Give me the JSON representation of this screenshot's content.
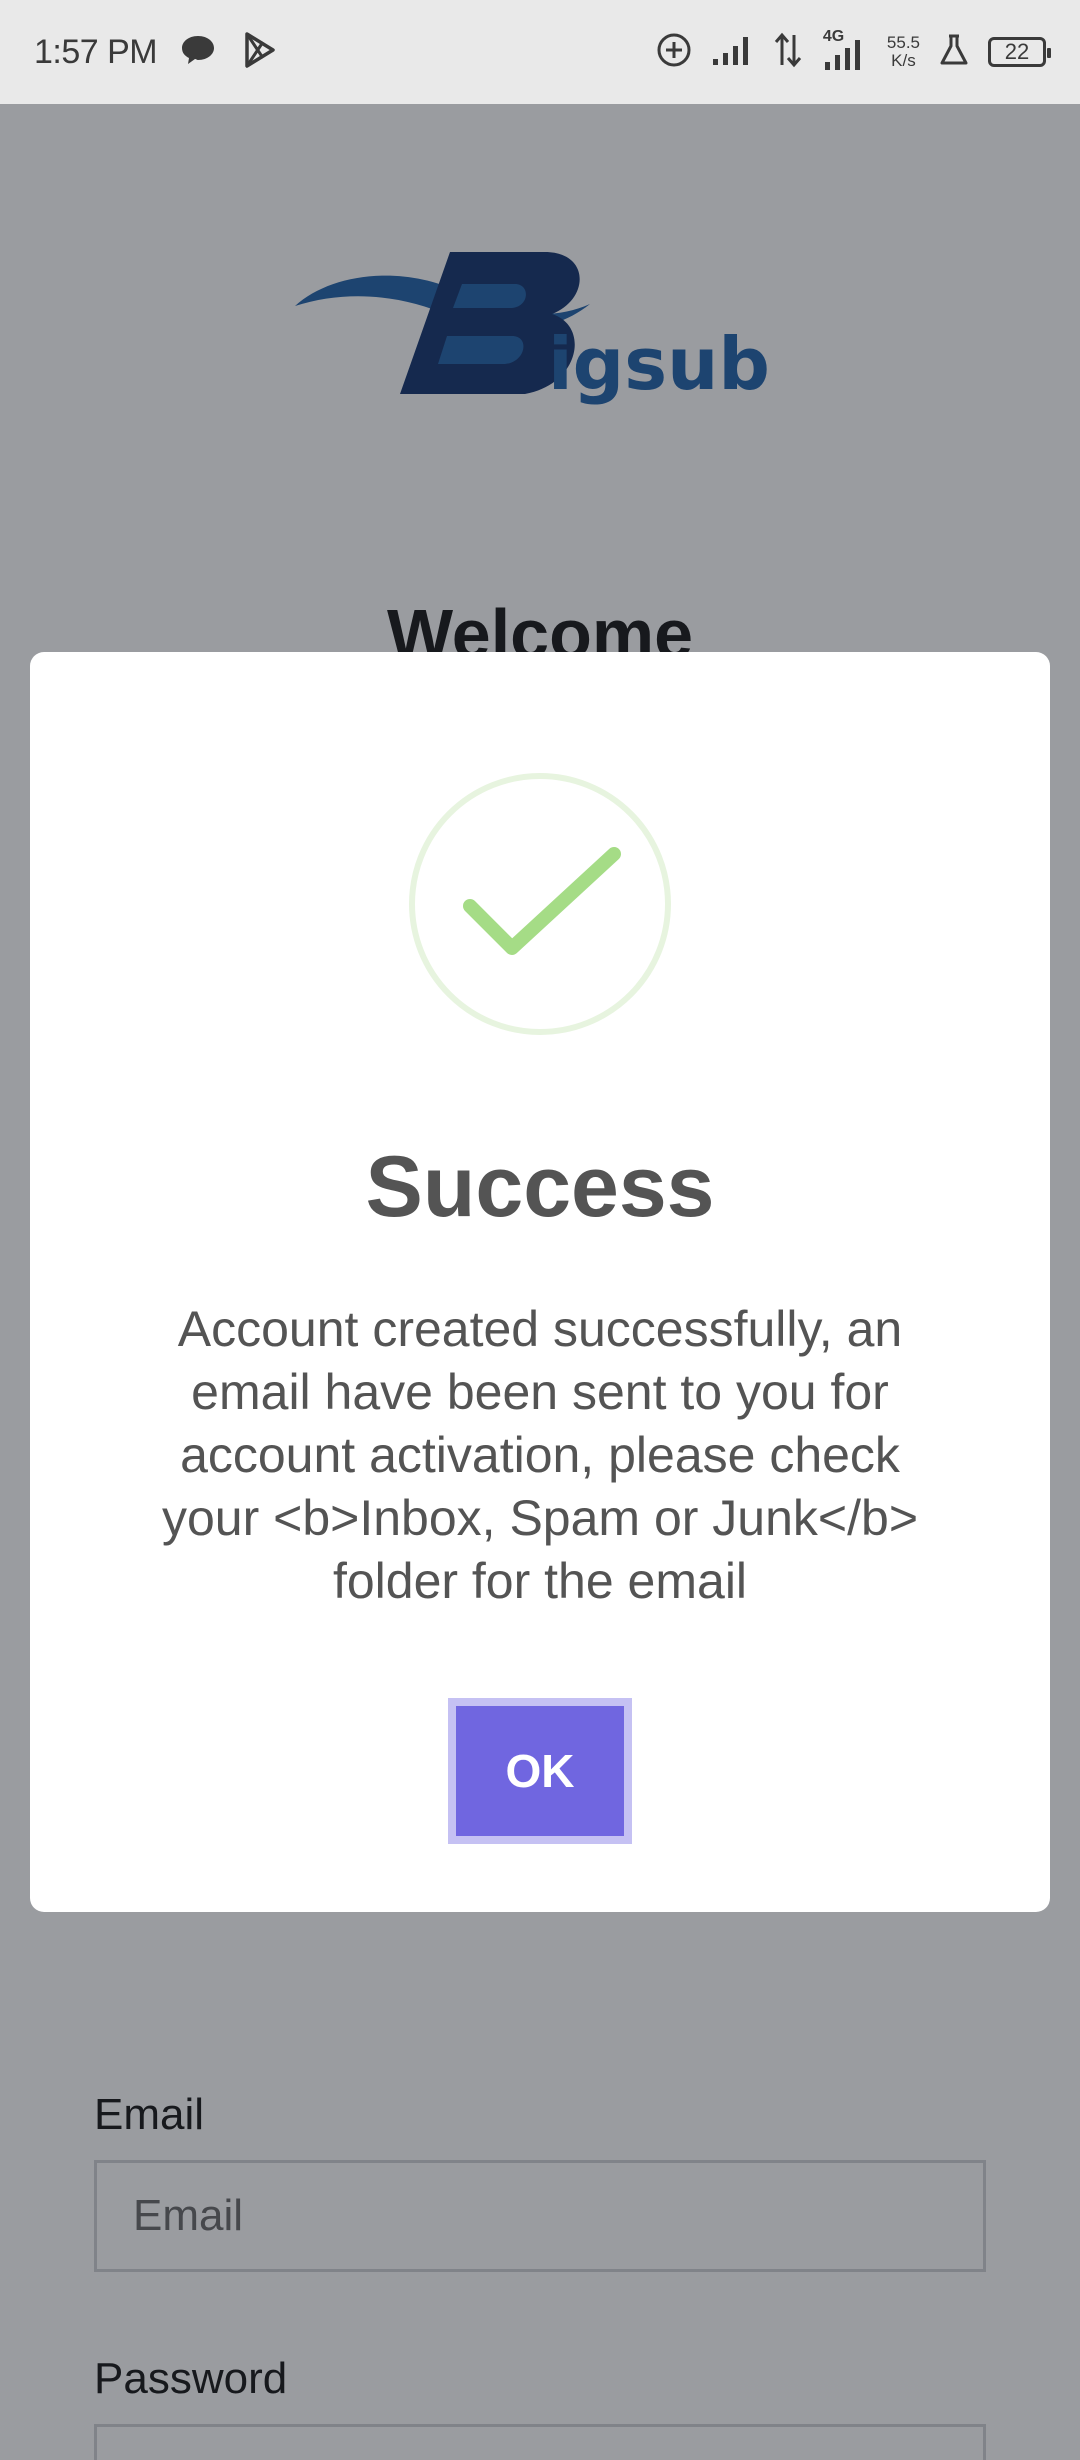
{
  "status_bar": {
    "time": "1:57 PM",
    "network_type": "4G",
    "net_speed_value": "55.5",
    "net_speed_unit": "K/s",
    "battery": "22",
    "icons": [
      "chat-bubble-icon",
      "play-store-icon",
      "data-saver-icon",
      "signal-icon",
      "data-arrows-icon",
      "signal-4g-icon",
      "lab-flask-icon",
      "battery-icon"
    ]
  },
  "page": {
    "logo_text": "Bigsub",
    "welcome": "Welcome",
    "email_label": "Email",
    "email_placeholder": "Email",
    "password_label": "Password"
  },
  "dialog": {
    "icon": "success-check-icon",
    "title": "Success",
    "message": "Account created successfully, an email have been sent to you for account activation, please check your <b>Inbox, Spam or Junk</b> folder for the email",
    "ok_label": "OK"
  },
  "colors": {
    "brand_blue": "#1d5fa8",
    "brand_navy": "#0d2f6b",
    "success_green": "#a5dc86",
    "success_ring": "#e7f4df",
    "ok_button": "#7066e0",
    "ok_button_ring": "#c5c1f3",
    "overlay": "rgba(30,35,45,0.45)"
  }
}
